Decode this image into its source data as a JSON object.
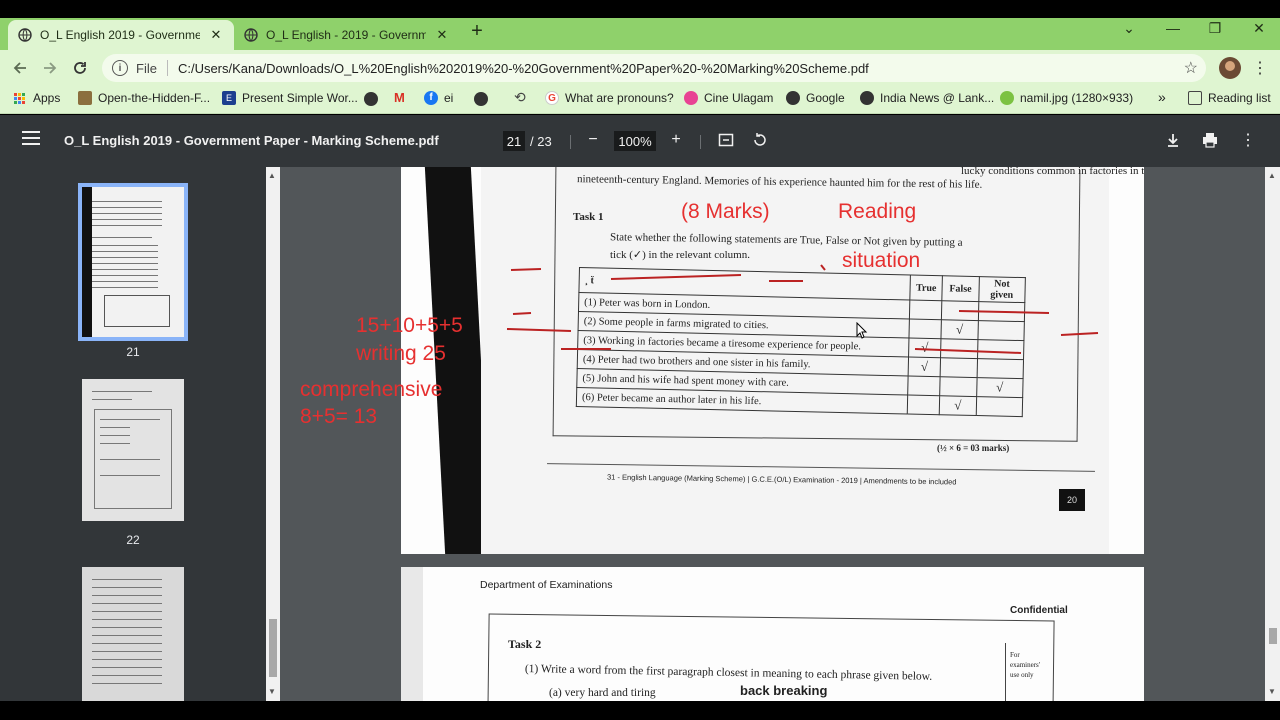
{
  "tabs": [
    {
      "title": "O_L English 2019 - Government P",
      "close": "✕"
    },
    {
      "title": "O_L English - 2019 - Government",
      "close": "✕"
    }
  ],
  "newtab": "+",
  "window": {
    "collapse": "⌄",
    "minimize": "—",
    "restore": "❐",
    "close": "✕"
  },
  "omnibox": {
    "scheme": "File",
    "url": "C:/Users/Kana/Downloads/O_L%20English%202019%20-%20Government%20Paper%20-%20Marking%20Scheme.pdf"
  },
  "bookmarks": [
    {
      "label": "Apps",
      "icon": "apps-grid-icon"
    },
    {
      "label": "Open-the-Hidden-F...",
      "icon": "bookmark-site-icon"
    },
    {
      "label": "Present Simple Wor...",
      "icon": "bookmark-site-icon"
    },
    {
      "label": "ei",
      "icon": "facebook-icon"
    },
    {
      "label": "What are pronouns?",
      "icon": "google-icon"
    },
    {
      "label": "Cine Ulagam",
      "icon": "bookmark-site-icon"
    },
    {
      "label": "Google",
      "icon": "globe-icon"
    },
    {
      "label": "India News @ Lank...",
      "icon": "globe-icon"
    },
    {
      "label": "namil.jpg (1280×933)",
      "icon": "image-icon"
    }
  ],
  "bookmarks_more": "»",
  "reading_list": "Reading list",
  "pdf": {
    "title": "O_L English 2019 - Government Paper - Marking Scheme.pdf",
    "current_page": "21",
    "total_pages": "/ 23",
    "zoom": "100%"
  },
  "thumbnails": [
    {
      "label": "21",
      "selected": true
    },
    {
      "label": "22",
      "selected": false
    }
  ],
  "page21": {
    "top_line1": "nineteenth-century England. Memories of his experience haunted him for the rest of his life.",
    "top_line0": "lucky conditions common in factories in the",
    "task": "Task 1",
    "instruction1": "State whether the following statements are True, False or Not given by putting a",
    "instruction2": "tick (✓) in the relevant column.",
    "headers": [
      "True",
      "False",
      "Not given"
    ],
    "rows": [
      {
        "text": "(1)  Peter was born in London.",
        "t": "",
        "f": "",
        "n": ""
      },
      {
        "text": "(2)  Some people in farms migrated to cities.",
        "t": "",
        "f": "√",
        "n": ""
      },
      {
        "text": "(3)  Working in factories became a tiresome experience for people.",
        "t": "√",
        "f": "",
        "n": ""
      },
      {
        "text": "(4)  Peter had two brothers and one sister in his family.",
        "t": "√",
        "f": "",
        "n": ""
      },
      {
        "text": "(5)  John and his wife had spent money with care.",
        "t": "",
        "f": "",
        "n": "√"
      },
      {
        "text": "(6)  Peter became an author later in his life.",
        "t": "",
        "f": "√",
        "n": ""
      }
    ],
    "marks_note": "(½ × 6 = 03 marks)",
    "footer": "31 - English Language (Marking Scheme) | G.C.E.(O/L) Examination - 2019 | Amendments to be included",
    "page_num": "20"
  },
  "annotations": {
    "marks": "(8 Marks)",
    "reading": "Reading",
    "situation": "situation",
    "sum": "15+10+5+5",
    "writing": "writing 25",
    "comprehensive": "comprehensive",
    "comp_sum": "8+5= 13",
    "back_breaking": "back breaking"
  },
  "page22": {
    "dept": "Department of Examinations",
    "confidential": "Confidential",
    "task": "Task 2",
    "q1": "(1)  Write a word from the first paragraph closest in meaning to each phrase given below.",
    "qa": "(a)  very hard and tiring",
    "side": [
      "For",
      "examiners'",
      "use only"
    ]
  }
}
